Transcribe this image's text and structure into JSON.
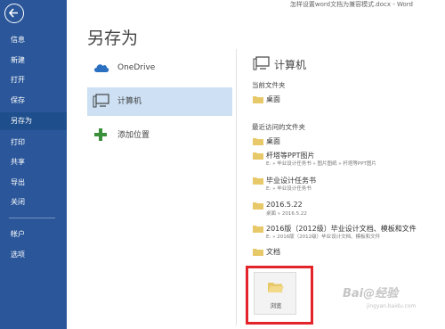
{
  "window": {
    "title": "怎样设置word文档为兼容模式.docx - Word"
  },
  "sidebar": {
    "items": [
      {
        "label": "信息"
      },
      {
        "label": "新建"
      },
      {
        "label": "打开"
      },
      {
        "label": "保存"
      },
      {
        "label": "另存为"
      },
      {
        "label": "打印"
      },
      {
        "label": "共享"
      },
      {
        "label": "导出"
      },
      {
        "label": "关闭"
      },
      {
        "label": "帐户"
      },
      {
        "label": "选项"
      }
    ]
  },
  "page": {
    "title": "另存为"
  },
  "places": [
    {
      "label": "OneDrive",
      "icon": "cloud-icon"
    },
    {
      "label": "计算机",
      "icon": "computer-icon"
    },
    {
      "label": "添加位置",
      "icon": "plus-icon"
    }
  ],
  "computer": {
    "title": "计算机",
    "current_folder_heading": "当前文件夹",
    "current_folder": {
      "name": "桌面"
    },
    "recent_heading": "最近访问的文件夹",
    "recent": [
      {
        "name": "桌面",
        "path": ""
      },
      {
        "name": "杆塔等PPT图片",
        "path": "E: » 毕业设计任务书 » 图片图纸 » 杆塔等PPT图片"
      },
      {
        "name": "毕业设计任务书",
        "path": "E: » 毕业设计任务书"
      },
      {
        "name": "2016.5.22",
        "path": "桌面 » 2016.5.22"
      },
      {
        "name": "2016版（2012级）毕业设计文档、模板和文件",
        "path": "E: » 2016版（2012级）毕业设计文档、模板和文件"
      },
      {
        "name": "文档",
        "path": ""
      }
    ],
    "browse_label": "浏览"
  },
  "watermark": {
    "text": "Bai@经验",
    "sub": "jingyan.baidu.com"
  },
  "colors": {
    "sidebar": "#2b579a",
    "highlight_outline": "#e3242b",
    "selected": "#cde0f4"
  }
}
